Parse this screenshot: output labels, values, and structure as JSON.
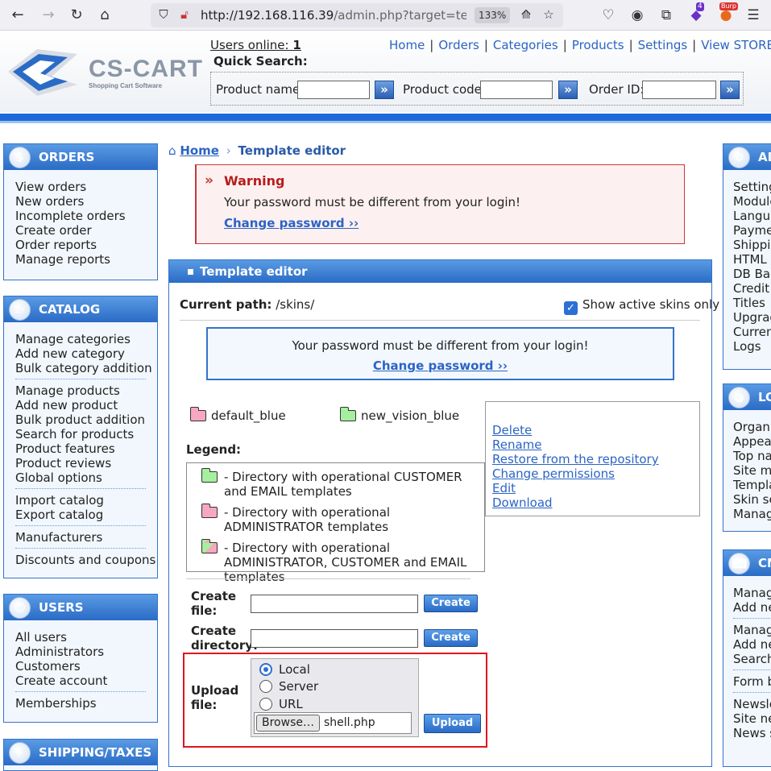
{
  "browser": {
    "url_host": "http://192.168.116.39",
    "url_path": "/admin.php?target=templat",
    "zoom": "133%",
    "extension_badge": "4",
    "ext_badge2": "Burp"
  },
  "header": {
    "brand": "CS-CART",
    "tagline": "Shopping Cart Software",
    "users_online_label": "Users online:",
    "users_online_count": "1",
    "nav": [
      "Home",
      "Orders",
      "Categories",
      "Products",
      "Settings",
      "View STOREFR"
    ],
    "quick_search_title": "Quick Search:",
    "product_name_label": "Product name:",
    "product_code_label": "Product code:",
    "order_id_label": "Order ID:",
    "go_glyph": "»"
  },
  "sidebar_left": {
    "orders": {
      "title": "ORDERS",
      "items": [
        "View orders",
        "New orders",
        "Incomplete orders",
        "Create order",
        "Order reports",
        "Manage reports"
      ]
    },
    "catalog": {
      "title": "CATALOG",
      "group1": [
        "Manage categories",
        "Add new category",
        "Bulk category addition"
      ],
      "group2": [
        "Manage products",
        "Add new product",
        "Bulk product addition",
        "Search for products",
        "Product features",
        "Product reviews",
        "Global options"
      ],
      "group3": [
        "Import catalog",
        "Export catalog"
      ],
      "group4": [
        "Manufacturers"
      ],
      "group5": [
        "Discounts and coupons"
      ]
    },
    "users": {
      "title": "USERS",
      "group1": [
        "All users",
        "Administrators",
        "Customers",
        "Create account"
      ],
      "group2": [
        "Memberships"
      ]
    },
    "shipping": {
      "title": "SHIPPING/TAXES"
    }
  },
  "sidebar_right": {
    "admin": {
      "title": "AD",
      "items": [
        "Setting",
        "Module",
        "Langua",
        "Payme",
        "Shippin",
        "HTML",
        "DB Bac",
        "Credit c",
        "Titles",
        "Upgrad",
        "Curren",
        "Logs"
      ]
    },
    "look": {
      "title": "LO",
      "items": [
        "Organi",
        "Appear",
        "Top na",
        "Site ma",
        "Templa",
        "Skin se",
        "Manag"
      ]
    },
    "cms": {
      "title": "CM",
      "group1": [
        "Manag",
        "Add ne"
      ],
      "group2": [
        "Manag",
        "Add ne",
        "Search"
      ],
      "group3": [
        "Form b"
      ],
      "group4": [
        "Newsle",
        "Site ne",
        "News s"
      ]
    }
  },
  "breadcrumb": {
    "home": "Home",
    "current": "Template editor"
  },
  "warning": {
    "title": "Warning",
    "message": "Your password must be different from your login!",
    "link": "Change password ››"
  },
  "template_editor": {
    "title": "Template editor",
    "current_path_label": "Current path:",
    "current_path_value": " /skins/",
    "show_active_label": "Show active skins only",
    "inner_message": "Your password must be different from your login!",
    "inner_link": "Change password ››",
    "skins": [
      "default_blue",
      "new_vision_blue"
    ],
    "legend_title": "Legend:",
    "legend": [
      "- Directory with operational CUSTOMER and EMAIL templates",
      "- Directory with operational ADMINISTRATOR templates",
      "- Directory with operational ADMINISTRATOR, CUSTOMER and EMAIL templates"
    ],
    "actions": [
      "Delete",
      "Rename",
      "Restore from the repository",
      "Change permissions",
      "Edit",
      "Download"
    ],
    "create_file_label": "Create file:",
    "create_dir_label": "Create directory:",
    "create_button": "Create",
    "upload_label": "Upload file:",
    "upload_options": [
      "Local",
      "Server",
      "URL"
    ],
    "upload_selected": "Local",
    "browse_button": "Browse…",
    "selected_file": "shell.php",
    "upload_button": "Upload"
  },
  "colors": {
    "accent_blue": "#2a6bc6",
    "link": "#2b64c5",
    "warning_red": "#b81c1c",
    "highlight_frame": "#e0141e"
  }
}
